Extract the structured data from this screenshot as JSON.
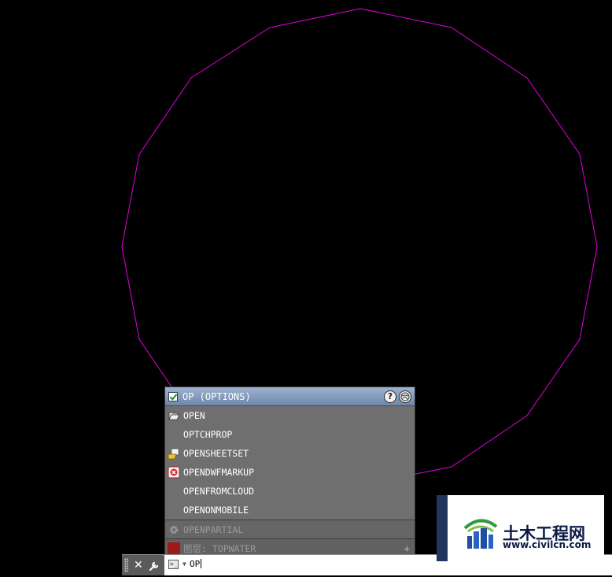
{
  "drawing": {
    "polygon_color": "#e000e0",
    "background": "#000000",
    "arrow_color": "#e8281e"
  },
  "autocomplete": {
    "header_label": "OP (OPTIONS)",
    "header_icons": [
      "check-icon",
      "help-icon",
      "globe-icon"
    ],
    "items": [
      {
        "label": "OPEN",
        "icon": "folder-open-icon"
      },
      {
        "label": "OPTCHPROP",
        "icon": ""
      },
      {
        "label": "OPENSHEETSET",
        "icon": "sheetset-icon"
      },
      {
        "label": "OPENDWFMARKUP",
        "icon": "dwf-markup-icon"
      },
      {
        "label": "OPENFROMCLOUD",
        "icon": ""
      },
      {
        "label": "OPENONMOBILE",
        "icon": ""
      }
    ],
    "disabled_item": {
      "label": "OPENPARTIAL",
      "icon": "gear-icon"
    },
    "layer_item": {
      "label": "图层: TOPWATER",
      "swatch_color": "#a01818"
    }
  },
  "command_line": {
    "input_value": "OP"
  },
  "watermark": {
    "title": "土木工程网",
    "url": "www.civilcn.com"
  }
}
